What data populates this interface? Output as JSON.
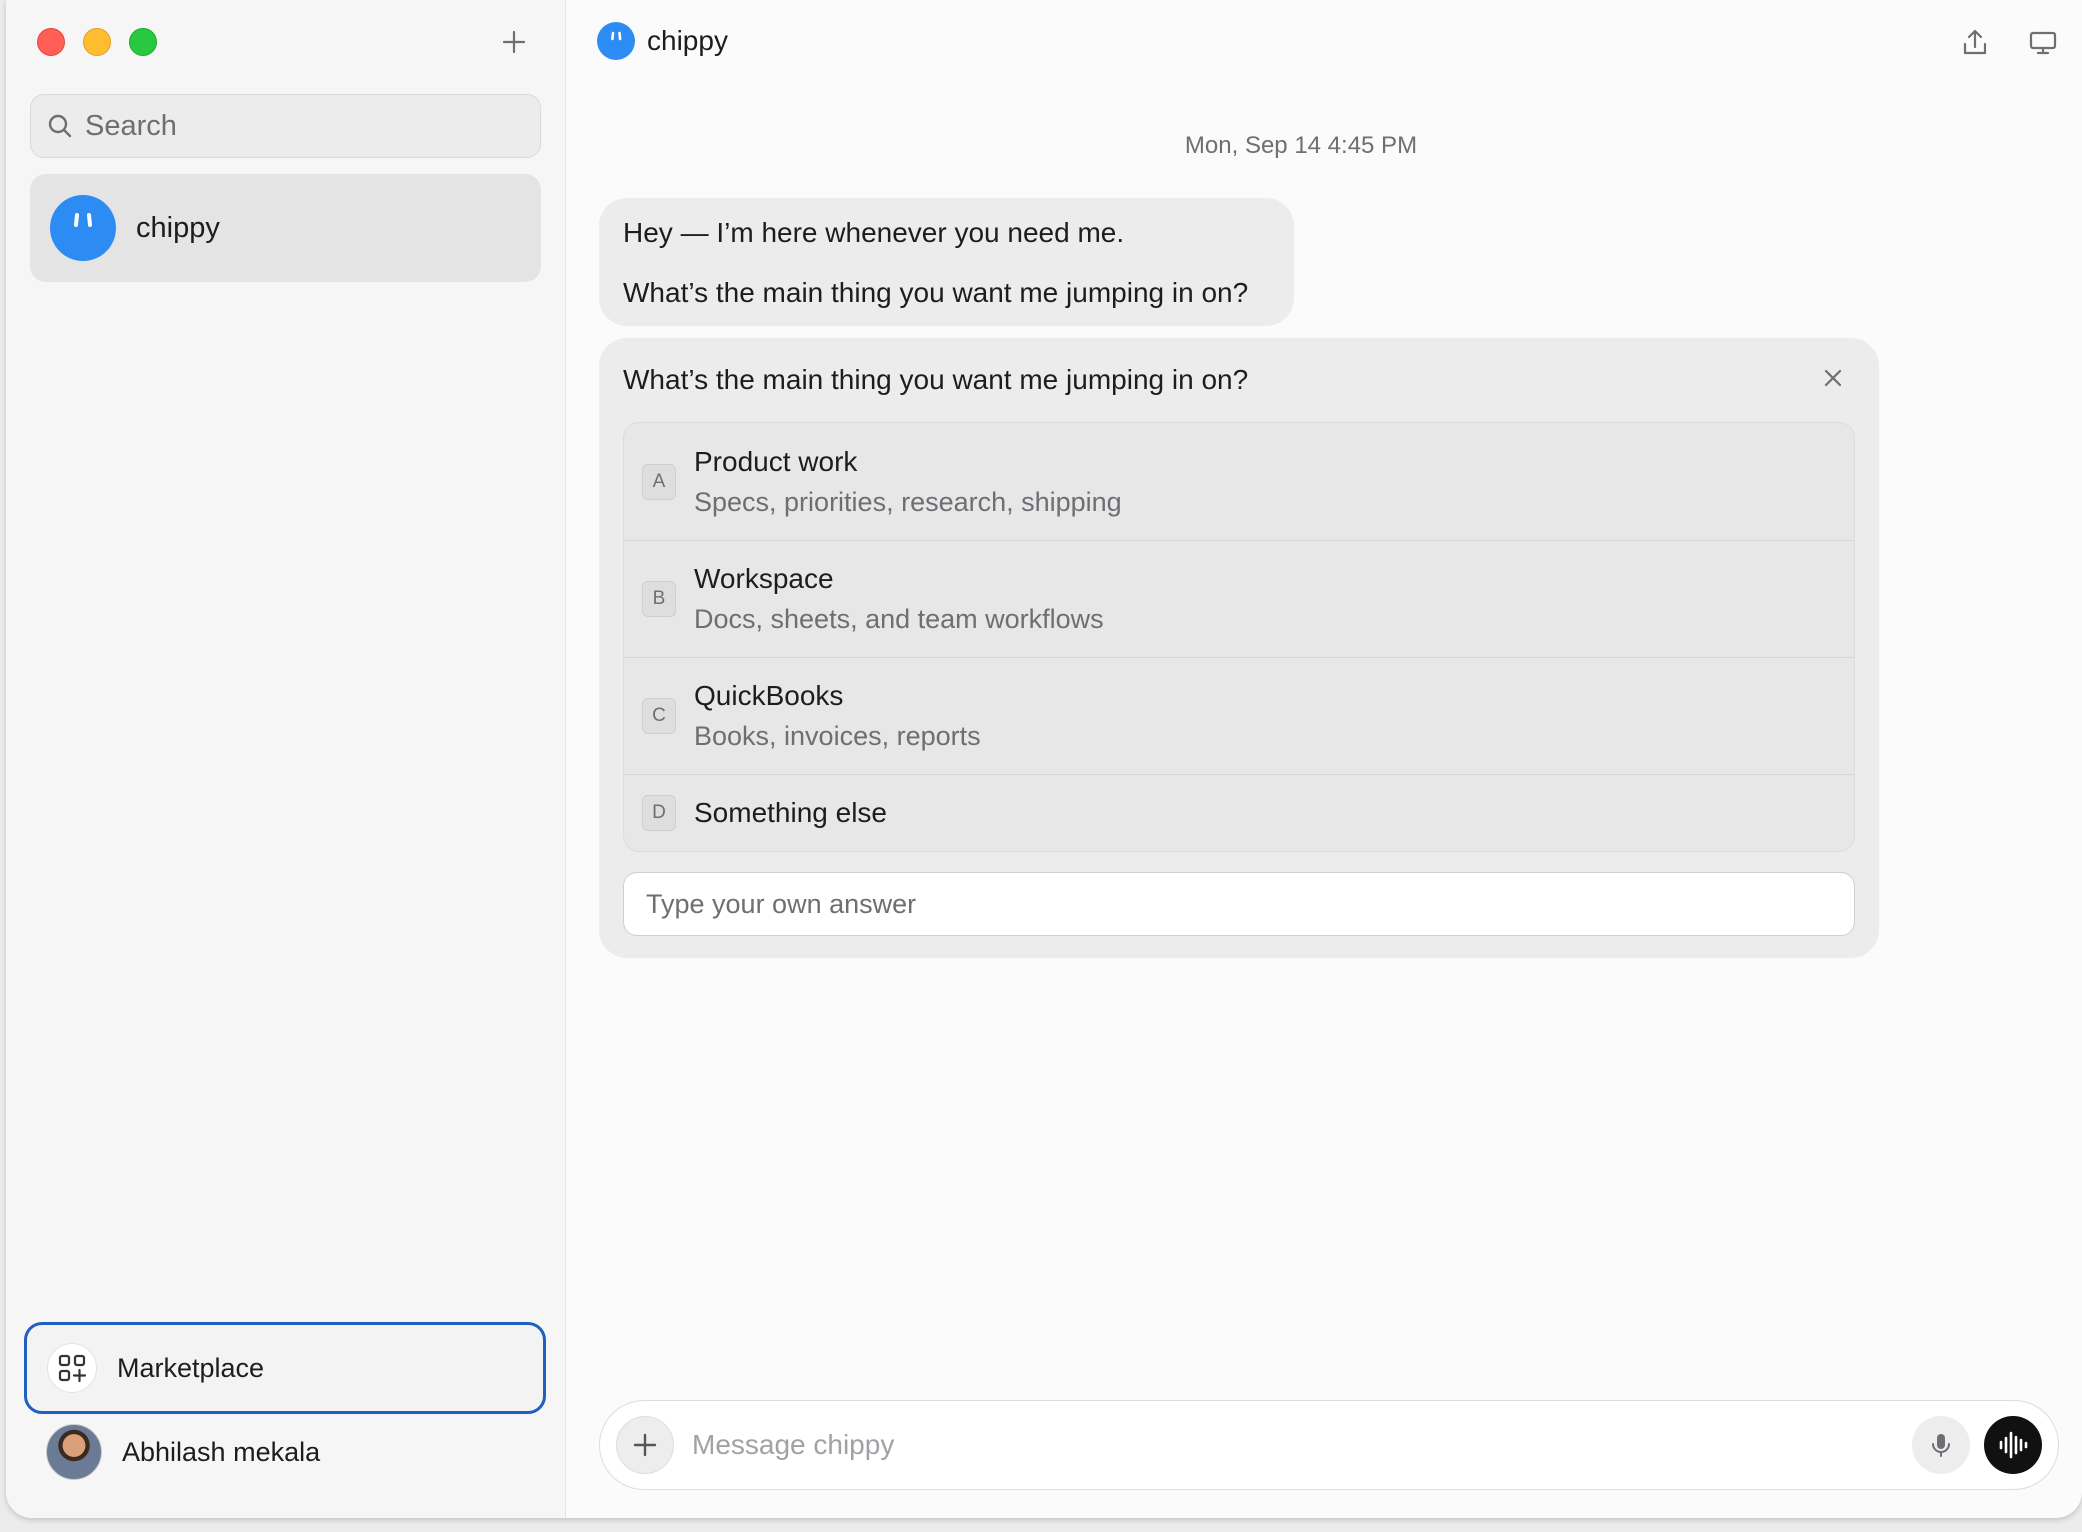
{
  "sidebar": {
    "search_placeholder": "Search",
    "conversation": {
      "name": "chippy"
    },
    "marketplace_label": "Marketplace",
    "user_name": "Abhilash mekala"
  },
  "header": {
    "title": "chippy"
  },
  "chat": {
    "timestamp": "Mon, Sep 14 4:45 PM",
    "message_lines": [
      "Hey — I’m here whenever you need me.",
      "What’s the main thing you want me jumping in on?"
    ],
    "question": {
      "title": "What’s the main thing you want me jumping in on?",
      "options": [
        {
          "key": "A",
          "label": "Product work",
          "description": "Specs, priorities, research, shipping"
        },
        {
          "key": "B",
          "label": "Workspace",
          "description": "Docs, sheets, and team workflows"
        },
        {
          "key": "C",
          "label": "QuickBooks",
          "description": "Books, invoices, reports"
        },
        {
          "key": "D",
          "label": "Something else",
          "description": ""
        }
      ],
      "answer_placeholder": "Type your own answer"
    }
  },
  "composer": {
    "placeholder": "Message chippy"
  },
  "colors": {
    "accent_blue": "#2c8cf4",
    "marketplace_border": "#1f5fbf",
    "traffic_red": "#ff5f57",
    "traffic_yellow": "#febc2e",
    "traffic_green": "#28c840"
  },
  "icons": [
    "plus-icon",
    "search-icon",
    "bot-face-icon",
    "grid-plus-icon",
    "share-icon",
    "monitor-icon",
    "close-icon",
    "microphone-icon",
    "waveform-icon"
  ]
}
